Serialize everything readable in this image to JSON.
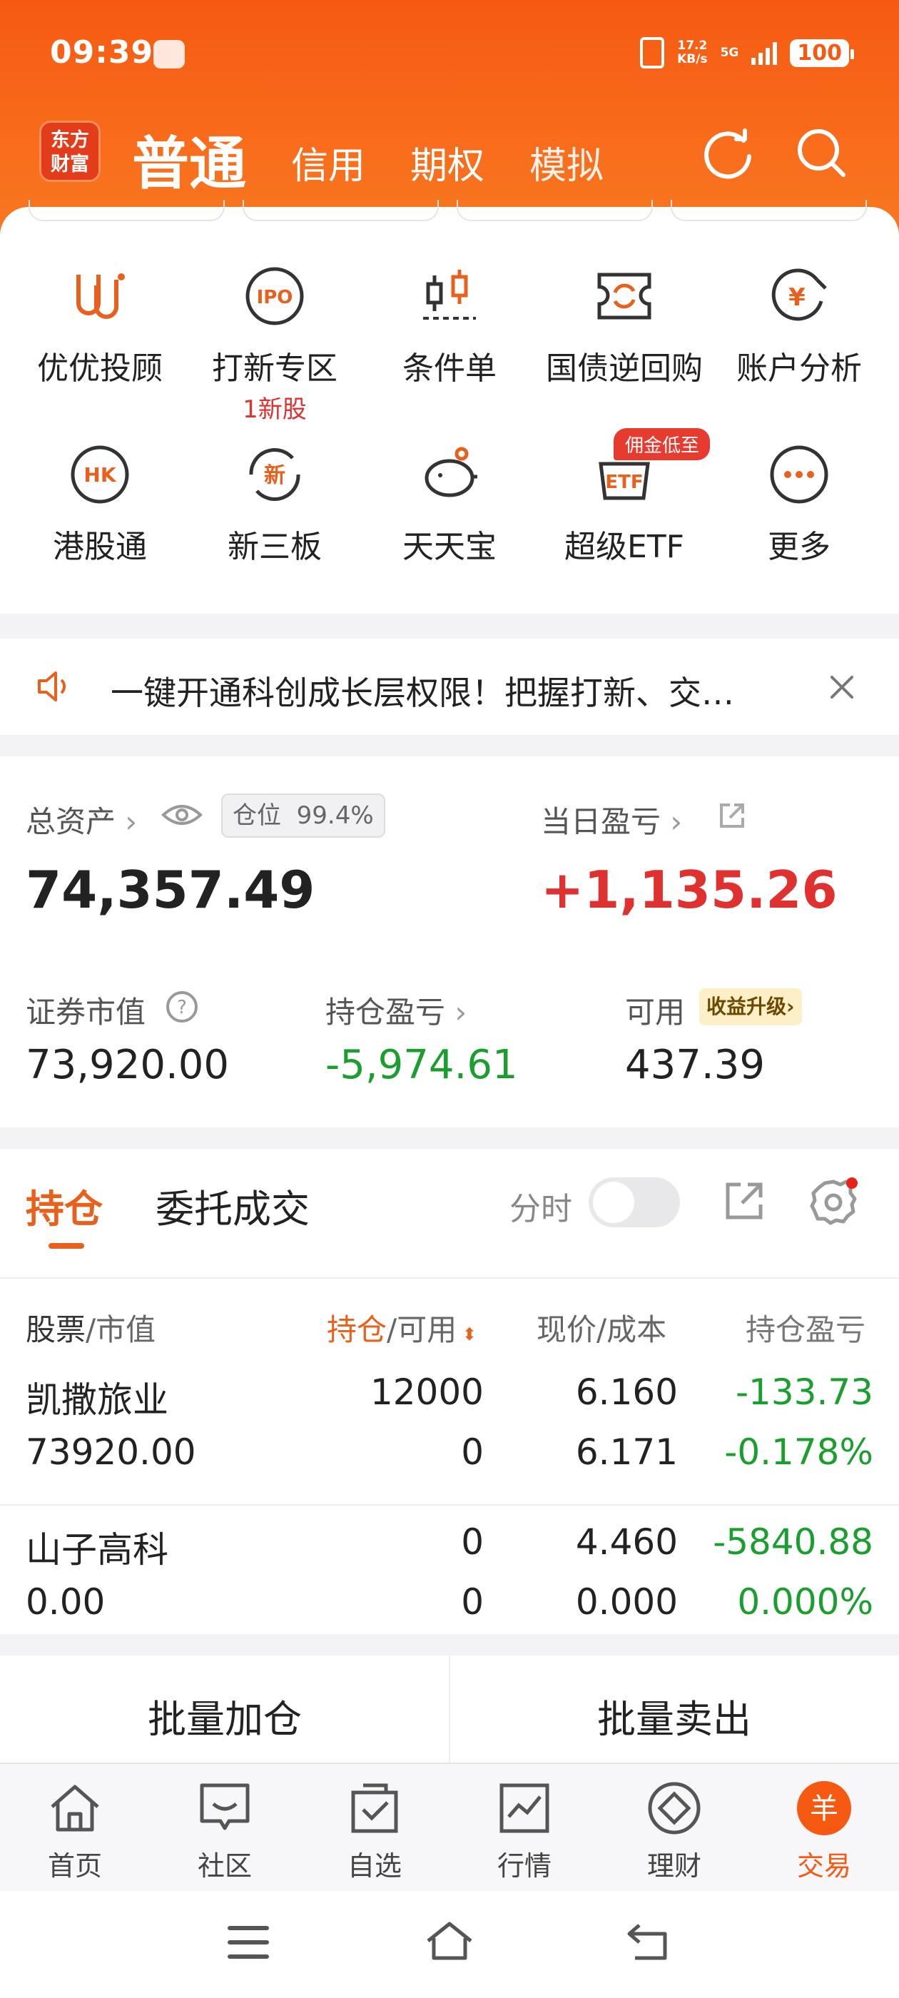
{
  "status": {
    "time": "09:39",
    "speed_value": "17.2",
    "speed_unit": "KB/s",
    "network": "5G",
    "battery": "100"
  },
  "nav": {
    "logo_line1": "东方",
    "logo_line2": "财富",
    "tabs": [
      "普通",
      "信用",
      "期权",
      "模拟"
    ]
  },
  "grid": [
    {
      "label": "优优投顾",
      "icon": "uu-advisor-icon"
    },
    {
      "label": "打新专区",
      "sub": "1新股",
      "icon": "ipo-icon"
    },
    {
      "label": "条件单",
      "icon": "condition-order-icon"
    },
    {
      "label": "国债逆回购",
      "icon": "reverse-repo-icon"
    },
    {
      "label": "账户分析",
      "icon": "account-analysis-icon"
    },
    {
      "label": "港股通",
      "icon": "hk-connect-icon"
    },
    {
      "label": "新三板",
      "icon": "neeq-icon"
    },
    {
      "label": "天天宝",
      "icon": "piggy-bank-icon"
    },
    {
      "label": "超级ETF",
      "icon": "etf-icon",
      "badge": "佣金低至"
    },
    {
      "label": "更多",
      "icon": "more-icon"
    }
  ],
  "notice": {
    "text": "一键开通科创成长层权限！把握打新、交…"
  },
  "assets": {
    "total_label": "总资产",
    "position_label": "仓位",
    "position_value": "99.4%",
    "total_value": "74,357.49",
    "daily_label": "当日盈亏",
    "daily_value": "+1,135.26",
    "market_label": "证券市值",
    "market_value": "73,920.00",
    "holding_pl_label": "持仓盈亏",
    "holding_pl_value": "-5,974.61",
    "avail_label": "可用",
    "upgrade_label": "收益升级",
    "avail_value": "437.39"
  },
  "holdings": {
    "tab_active": "持仓",
    "tab_other": "委托成交",
    "toggle_label": "分时",
    "col1a": "股票",
    "col1b": "/市值",
    "col2a": "持仓",
    "col2b": "/可用",
    "col3": "现价/成本",
    "col4": "持仓盈亏",
    "rows": [
      {
        "name": "凯撒旅业",
        "mv": "73920.00",
        "qty": "12000",
        "avail": "0",
        "price": "6.160",
        "cost": "6.171",
        "pl": "-133.73",
        "plpct": "-0.178%"
      },
      {
        "name": "山子高科",
        "mv": "0.00",
        "qty": "0",
        "avail": "0",
        "price": "4.460",
        "cost": "0.000",
        "pl": "-5840.88",
        "plpct": "0.000%"
      }
    ]
  },
  "actions": {
    "batch_add": "批量加仓",
    "batch_sell": "批量卖出"
  },
  "tabbar": [
    {
      "label": "首页",
      "icon": "home-icon"
    },
    {
      "label": "社区",
      "icon": "community-icon"
    },
    {
      "label": "自选",
      "icon": "watchlist-icon"
    },
    {
      "label": "行情",
      "icon": "market-icon"
    },
    {
      "label": "理财",
      "icon": "wealth-icon"
    },
    {
      "label": "交易",
      "icon": "trade-icon",
      "active": true
    }
  ],
  "colors": {
    "brand": "#f65a12",
    "up": "#e03131",
    "down": "#1a9e2e"
  }
}
